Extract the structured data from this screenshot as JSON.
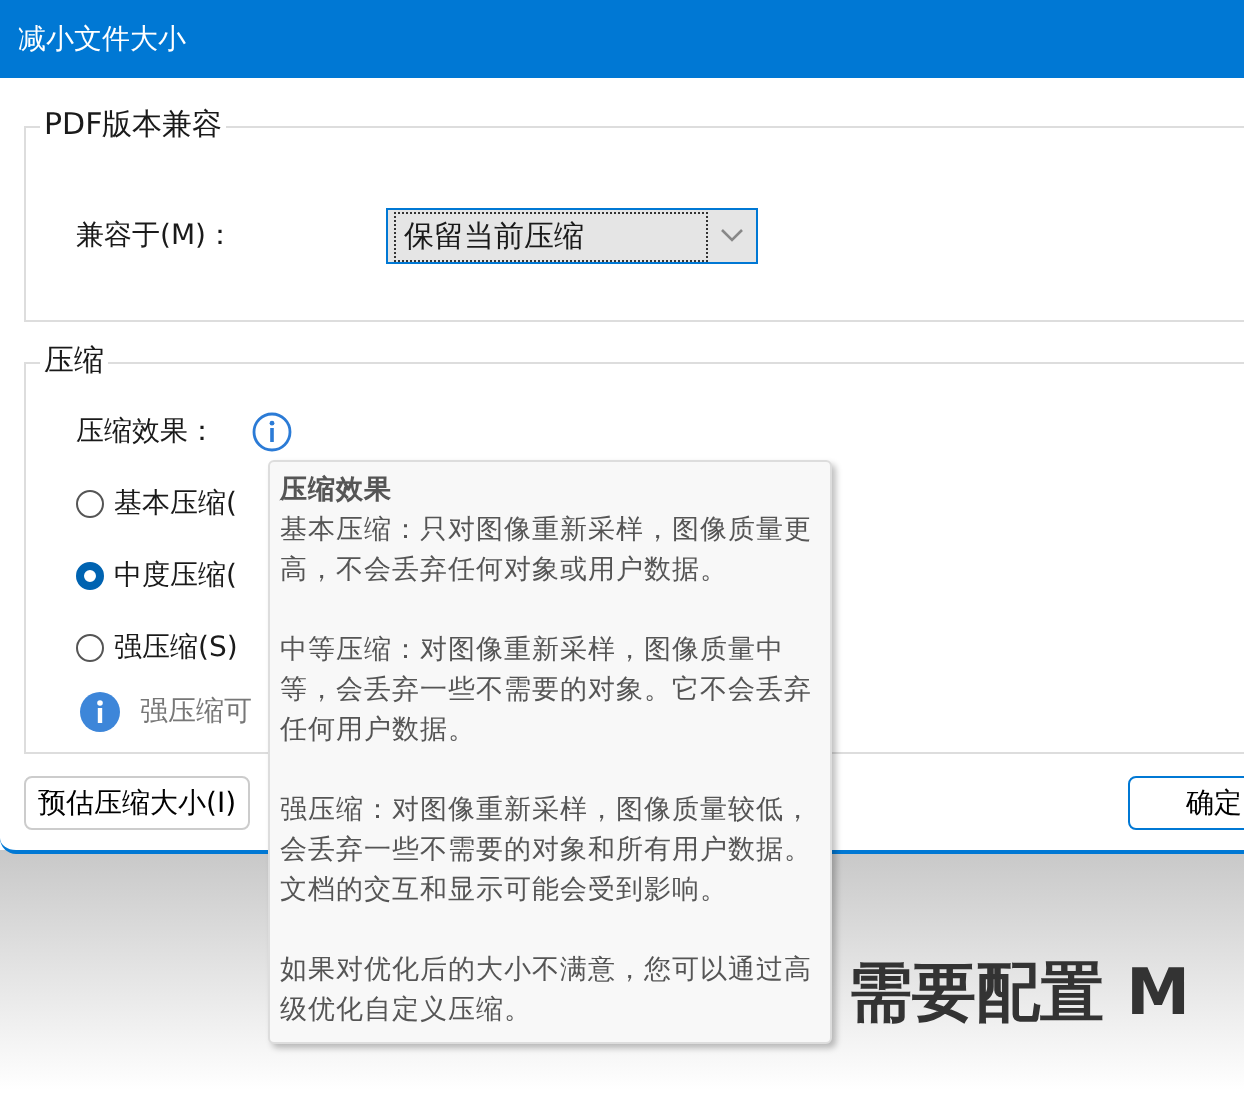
{
  "window": {
    "title": "减小文件大小"
  },
  "compat_group": {
    "title": "PDF版本兼容",
    "label": "兼容于(M)：",
    "dropdown": {
      "value": "保留当前压缩"
    }
  },
  "compression_group": {
    "title": "压缩",
    "effect_label": "压缩效果：",
    "options": [
      {
        "label": "基本压缩(",
        "selected": false
      },
      {
        "label": "中度压缩(",
        "selected": true
      },
      {
        "label": "强压缩(S)",
        "selected": false
      }
    ],
    "note": "强压缩可"
  },
  "buttons": [
    {
      "label": "预估压缩大小(I)",
      "kind": "normal"
    },
    {
      "label": "确定",
      "kind": "default"
    }
  ],
  "tooltip": {
    "title": "压缩效果",
    "paragraphs": [
      "基本压缩：只对图像重新采样，图像质量更高，不会丢弃任何对象或用户数据。",
      "中等压缩：对图像重新采样，图像质量中等，会丢弃一些不需要的对象。它不会丢弃任何用户数据。",
      "强压缩：对图像重新采样，图像质量较低，会丢弃一些不需要的对象和所有用户数据。文档的交互和显示可能会受到影响。",
      "如果对优化后的大小不满意，您可以通过高级优化自定义压缩。"
    ]
  },
  "background_page": {
    "heading": "需要配置 M"
  }
}
